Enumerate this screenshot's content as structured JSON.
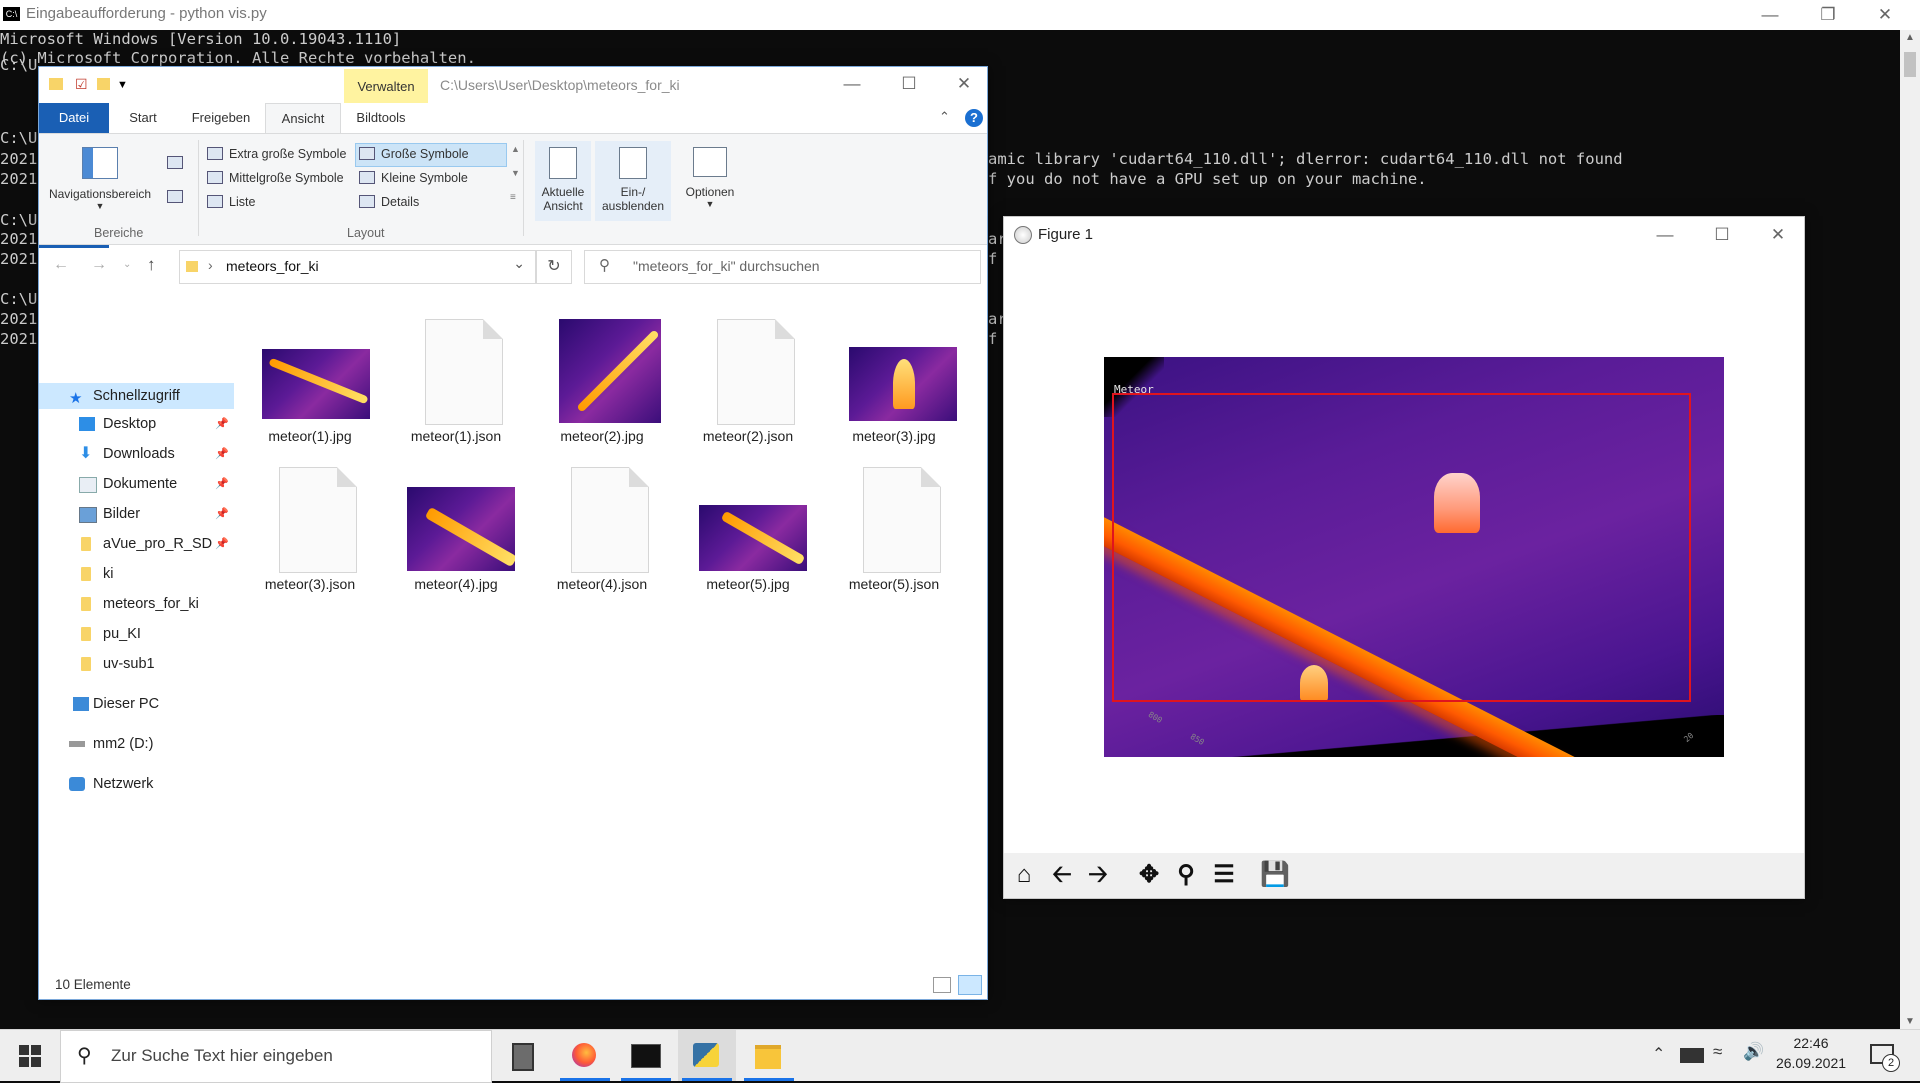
{
  "cmd": {
    "title": "Eingabeaufforderung - python  vis.py",
    "lines": [
      "Microsoft Windows [Version 10.0.19043.1110]",
      "(c) Microsoft Corporation. Alle Rechte vorbehalten."
    ],
    "left_fragments": [
      "C:\\U",
      "C:\\U",
      "2021",
      "2021",
      "C:\\U",
      "2021",
      "2021",
      "C:\\U",
      "2021",
      "2021"
    ],
    "right_line_1": "amic library 'cudart64_110.dll'; dlerror: cudart64_110.dll not found",
    "right_line_2": "f you do not have a GPU set up on your machine.",
    "right_fragments": [
      "ar",
      "f",
      "ar",
      "f"
    ]
  },
  "explorer": {
    "verwalten": "Verwalten",
    "title_path": "C:\\Users\\User\\Desktop\\meteors_for_ki",
    "tabs": [
      "Datei",
      "Start",
      "Freigeben",
      "Ansicht",
      "Bildtools"
    ],
    "ribbon": {
      "nav_pane": "Navigationsbereich",
      "group_bereiche": "Bereiche",
      "layout_items": [
        "Extra große Symbole",
        "Große Symbole",
        "Mittelgroße Symbole",
        "Kleine Symbole",
        "Liste",
        "Details"
      ],
      "group_layout": "Layout",
      "current_view_1": "Aktuelle",
      "current_view_2": "Ansicht",
      "show_hide_1": "Ein-/",
      "show_hide_2": "ausblenden",
      "options": "Optionen"
    },
    "address": "meteors_for_ki",
    "search_placeholder": "\"meteors_for_ki\" durchsuchen",
    "tree": [
      {
        "label": "Schnellzugriff"
      },
      {
        "label": "Desktop"
      },
      {
        "label": "Downloads"
      },
      {
        "label": "Dokumente"
      },
      {
        "label": "Bilder"
      },
      {
        "label": "aVue_pro_R_SD"
      },
      {
        "label": "ki"
      },
      {
        "label": "meteors_for_ki"
      },
      {
        "label": "pu_KI"
      },
      {
        "label": "uv-sub1"
      },
      {
        "label": "Dieser PC"
      },
      {
        "label": "mm2 (D:)"
      },
      {
        "label": "Netzwerk"
      }
    ],
    "files": [
      {
        "name": "meteor(1).jpg",
        "type": "image"
      },
      {
        "name": "meteor(1).json",
        "type": "doc"
      },
      {
        "name": "meteor(2).jpg",
        "type": "image"
      },
      {
        "name": "meteor(2).json",
        "type": "doc"
      },
      {
        "name": "meteor(3).jpg",
        "type": "image"
      },
      {
        "name": "meteor(3).json",
        "type": "doc"
      },
      {
        "name": "meteor(4).jpg",
        "type": "image"
      },
      {
        "name": "meteor(4).json",
        "type": "doc"
      },
      {
        "name": "meteor(5).jpg",
        "type": "image"
      },
      {
        "name": "meteor(5).json",
        "type": "doc"
      }
    ],
    "status": "10 Elemente"
  },
  "figure": {
    "title": "Figure 1",
    "annotation": "Meteor",
    "axis_ticks": [
      "800",
      "850",
      "20"
    ],
    "colors": {
      "box": "#e0141e",
      "streak": "#ff6a00"
    }
  },
  "taskbar": {
    "search_placeholder": "Zur Suche Text hier eingeben",
    "time": "22:46",
    "date": "26.09.2021",
    "notification_count": "2"
  }
}
